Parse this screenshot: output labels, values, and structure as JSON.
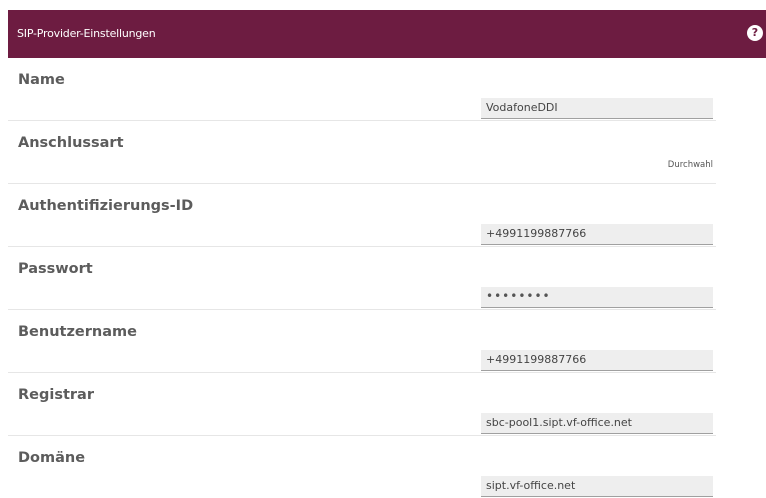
{
  "header": {
    "title": "SIP-Provider-Einstellungen",
    "help_icon": "?"
  },
  "fields": {
    "name": {
      "label": "Name",
      "value": "VodafoneDDI"
    },
    "anschlussart": {
      "label": "Anschlussart",
      "value": "Durchwahl"
    },
    "auth_id": {
      "label": "Authentifizierungs-ID",
      "value": "+4991199887766"
    },
    "passwort": {
      "label": "Passwort",
      "value": "••••••••"
    },
    "benutzername": {
      "label": "Benutzername",
      "value": "+4991199887766"
    },
    "registrar": {
      "label": "Registrar",
      "value": "sbc-pool1.sipt.vf-office.net"
    },
    "domaene": {
      "label": "Domäne",
      "value": "sipt.vf-office.net"
    }
  }
}
